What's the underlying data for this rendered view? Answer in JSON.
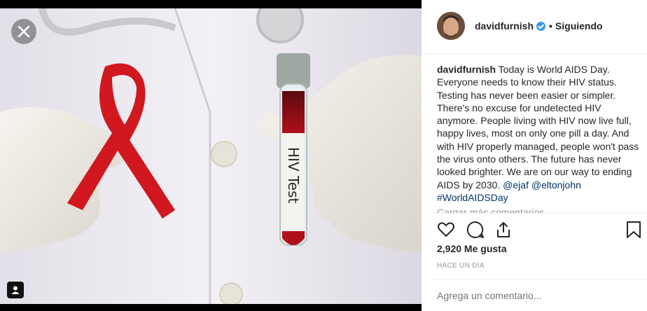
{
  "post": {
    "username": "davidfurnish",
    "follow_status": "Siguiendo",
    "separator": "•",
    "caption_user": "davidfurnish",
    "caption_text": "Today is World AIDS Day. Everyone needs to know their HIV status. Testing has never been easier or simpler. There's no excuse for undetected HIV anymore. People living with HIV now live full, happy lives, most on only one pill a day. And with HIV properly managed, people won't pass the virus onto others. The future has never looked brighter. We are on our way to ending AIDS by 2030.",
    "mention_1": "@ejaf",
    "mention_2": "@eltonjohn",
    "hashtag": "#WorldAIDSDay",
    "load_more": "Cargar más comentarios",
    "likes": "2,920 Me gusta",
    "time_ago": "HACE UN DÍA",
    "comment_placeholder": "Agrega un comentario..."
  },
  "image": {
    "tube_label": "HIV Test"
  },
  "icons": {
    "close": "close-icon",
    "tag": "user-tag-icon",
    "like": "heart-icon",
    "comment": "comment-icon",
    "share": "share-icon",
    "save": "bookmark-icon",
    "verified": "verified-badge-icon"
  },
  "colors": {
    "ribbon": "#d0181e",
    "link": "#003569",
    "verified": "#3897f0"
  }
}
